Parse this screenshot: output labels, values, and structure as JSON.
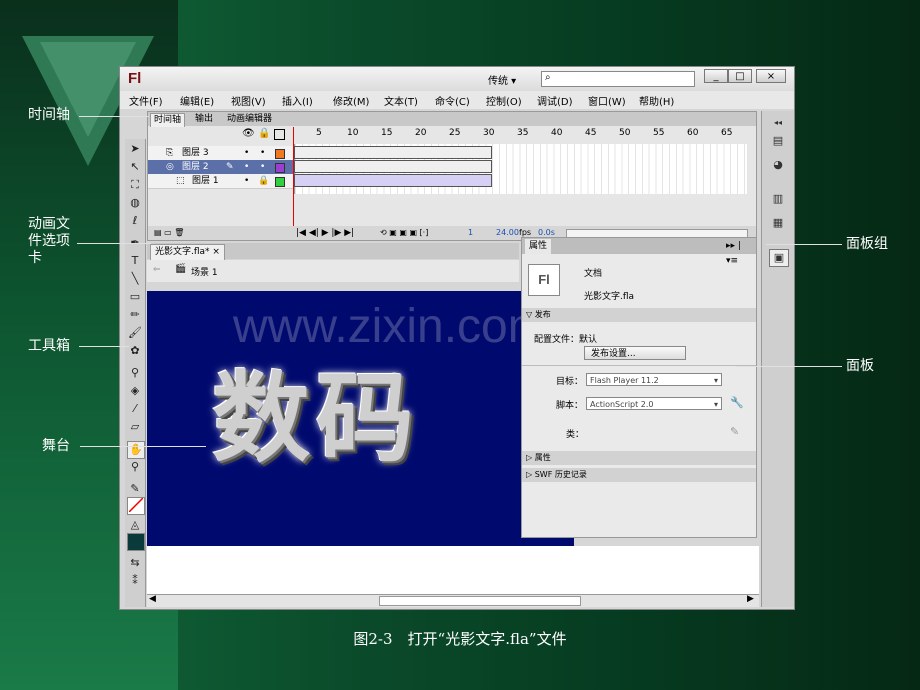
{
  "callouts": {
    "timeline": "时间轴",
    "doc_tab": "动画文件选项卡",
    "toolbox": "工具箱",
    "stage": "舞台",
    "panel_group": "面板组",
    "panel": "面板"
  },
  "caption": "图2-3　打开“光影文字.fla”文件",
  "app": {
    "logo": "Fl",
    "workspace": "传统",
    "window_buttons": [
      "_",
      "□",
      "×"
    ]
  },
  "menu": [
    "文件(F)",
    "编辑(E)",
    "视图(V)",
    "插入(I)",
    "修改(M)",
    "文本(T)",
    "命令(C)",
    "控制(O)",
    "调试(D)",
    "窗口(W)",
    "帮助(H)"
  ],
  "timeline": {
    "tabs": [
      "时间轴",
      "输出",
      "动画编辑器"
    ],
    "frame_numbers": [
      "5",
      "10",
      "15",
      "20",
      "25",
      "30",
      "35",
      "40",
      "45",
      "50",
      "55",
      "60",
      "65"
    ],
    "layers": [
      {
        "name": "图层 3",
        "color": "#f07820"
      },
      {
        "name": "图层 2",
        "color": "#9b3fd0"
      },
      {
        "name": "图层 1",
        "color": "#30d040"
      }
    ],
    "current_frame": "1",
    "fps": "24.00",
    "fps_unit": "fps",
    "time": "0.0s"
  },
  "document": {
    "tab": "光影文字.fla*",
    "scene": "场景 1",
    "stage_text": "数码",
    "watermark": "www.zixin.com.cn"
  },
  "properties": {
    "tab": "属性",
    "doc_label": "文档",
    "file_name": "光影文字.fla",
    "publish_section": "发布",
    "profile_label": "配置文件：默认",
    "publish_settings_button": "发布设置...",
    "target_label": "目标：",
    "target_value": "Flash Player 11.2",
    "script_label": "脚本：",
    "script_value": "ActionScript 2.0",
    "class_label": "类：",
    "attr_section": "属性",
    "swf_section": "SWF 历史记录"
  }
}
